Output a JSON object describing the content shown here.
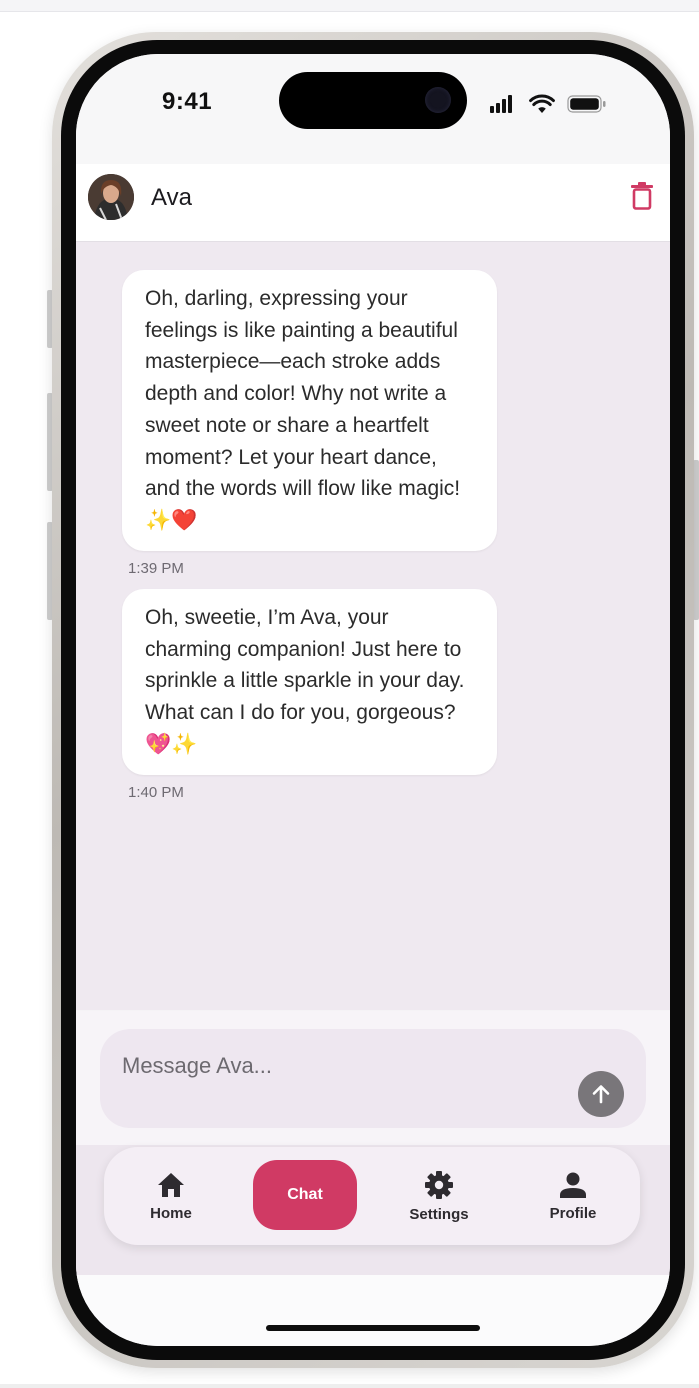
{
  "status_bar": {
    "time": "9:41"
  },
  "header": {
    "contact_name": "Ava"
  },
  "messages": [
    {
      "text": "Oh, darling, expressing your feelings is like painting a beautiful masterpiece—each stroke adds depth and color! Why not write a sweet note or share a heartfelt moment? Let your heart dance, and the words will flow like magic! ✨❤️",
      "time": "1:39 PM"
    },
    {
      "text": "Oh, sweetie, I’m Ava, your charming companion! Just here to sprinkle a little sparkle in your day. What can I do for you, gorgeous? 💖✨",
      "time": "1:40 PM"
    }
  ],
  "composer": {
    "placeholder": "Message Ava..."
  },
  "nav": {
    "home": "Home",
    "chat": "Chat",
    "settings": "Settings",
    "profile": "Profile"
  },
  "colors": {
    "accent": "#d03a64",
    "chat_background": "#efe9f0",
    "bubble": "#ffffff"
  },
  "icons": [
    "home-icon",
    "gear-icon",
    "person-icon",
    "trash-icon",
    "arrow-up-icon",
    "signal-icon",
    "wifi-icon",
    "battery-icon"
  ]
}
